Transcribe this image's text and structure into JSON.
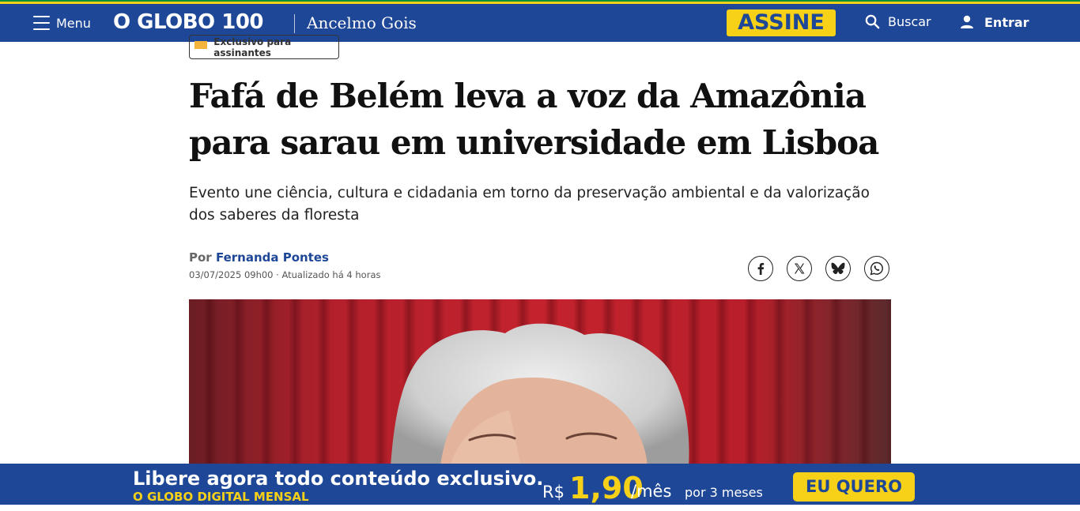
{
  "header": {
    "menu_label": "Menu",
    "logo_text": "O GLOBO",
    "logo_anniversary": "100",
    "column_name": "Ancelmo Gois",
    "subscribe_label": "ASSINE",
    "search_label": "Buscar",
    "login_label": "Entrar"
  },
  "article": {
    "badge": "Exclusivo para assinantes",
    "headline": "Fafá de Belém leva a voz da Amazônia para sarau em universidade em Lisboa",
    "subtitle": "Evento une ciência, cultura e cidadania em torno da preservação ambiental e da valorização dos saberes da floresta",
    "byline_prefix": "Por",
    "author": "Fernanda Pontes",
    "dateline": "03/07/2025 09h00 · Atualizado há 4 horas",
    "share_icons": [
      "facebook-icon",
      "x-icon",
      "bluesky-icon",
      "whatsapp-icon"
    ]
  },
  "promo": {
    "headline": "Libere agora todo conteúdo exclusivo.",
    "plan": "O GLOBO DIGITAL MENSAL",
    "currency": "R$",
    "price": "1,90",
    "unit": "/mês",
    "period": "por 3 meses",
    "cta": "EU QUERO"
  },
  "colors": {
    "brand_blue": "#1e4797",
    "accent_yellow": "#f7d117",
    "stripe_green": "#0a8f3c"
  }
}
